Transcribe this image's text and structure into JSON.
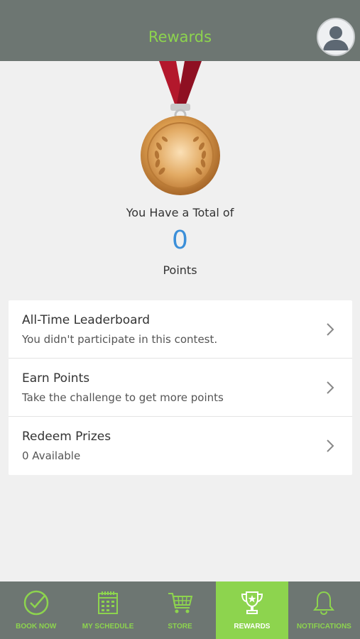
{
  "header": {
    "title": "Rewards",
    "avatar_icon": "user-avatar-icon"
  },
  "points": {
    "total_label": "You Have a Total of",
    "value": "0",
    "unit_label": "Points"
  },
  "menu": [
    {
      "title": "All-Time Leaderboard",
      "subtitle": "You didn't participate in this contest."
    },
    {
      "title": "Earn Points",
      "subtitle": "Take the challenge to get more points"
    },
    {
      "title": "Redeem Prizes",
      "subtitle": "0 Available"
    }
  ],
  "tabs": [
    {
      "label": "BOOK NOW",
      "icon": "check-circle-icon",
      "active": false
    },
    {
      "label": "MY SCHEDULE",
      "icon": "calendar-icon",
      "active": false
    },
    {
      "label": "STORE",
      "icon": "cart-icon",
      "active": false
    },
    {
      "label": "REWARDS",
      "icon": "trophy-icon",
      "active": true
    },
    {
      "label": "NOTIFICATIONS",
      "icon": "bell-icon",
      "active": false
    }
  ],
  "colors": {
    "header_bg": "#6d7672",
    "accent_green": "#8dd44e",
    "points_blue": "#3b8fd9",
    "ribbon_red": "#b3182c",
    "medal_gold": "#d79a4a"
  }
}
